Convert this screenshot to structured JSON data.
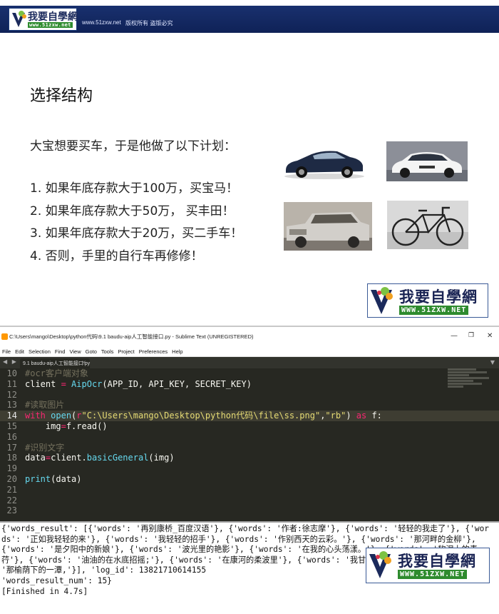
{
  "slide": {
    "header": {
      "logo_text": "我要自學網",
      "logo_url": "www.51zxw.net",
      "site": "www.51zxw.net",
      "rights": "版权所有 盗版必究"
    },
    "title": "选择结构",
    "intro": "大宝想要买车，于是他做了以下计划：",
    "plan": [
      "1. 如果年底存款大于100万，买宝马！",
      "2. 如果年底存款大于50万，  买丰田！",
      "3. 如果年底存款大于20万，买二手车！",
      "4. 否则，手里的自行车再修修！"
    ],
    "watermark_logo": {
      "text": "我要自學網",
      "url": "WWW.51ZXW.NET"
    }
  },
  "window": {
    "title": "C:\\Users\\mango\\Desktop\\python代码\\9.1 baudu-aip人工智能接口.py - Sublime Text (UNREGISTERED)",
    "controls": {
      "minimize": "—",
      "maximize": "❐",
      "close": "✕"
    },
    "menu": [
      "File",
      "Edit",
      "Selection",
      "Find",
      "View",
      "Goto",
      "Tools",
      "Project",
      "Preferences",
      "Help"
    ],
    "tab": {
      "label": "9.1 baudu-aip人工智能接口.py",
      "close": "×"
    },
    "tab_nav": "◀ ▶",
    "tab_menu": "▼"
  },
  "editor": {
    "active_line": 14,
    "lines": [
      {
        "n": "10",
        "tokens": [
          {
            "t": "#ocr客户端对象",
            "c": "comment"
          }
        ]
      },
      {
        "n": "11",
        "tokens": [
          {
            "t": "client ",
            "c": "plain"
          },
          {
            "t": "=",
            "c": "kw"
          },
          {
            "t": " ",
            "c": "plain"
          },
          {
            "t": "AipOcr",
            "c": "fn"
          },
          {
            "t": "(APP_ID, API_KEY, SECRET_KEY)",
            "c": "plain"
          }
        ]
      },
      {
        "n": "12",
        "tokens": []
      },
      {
        "n": "13",
        "tokens": [
          {
            "t": "#读取图片",
            "c": "comment"
          }
        ]
      },
      {
        "n": "14",
        "tokens": [
          {
            "t": "with",
            "c": "kw"
          },
          {
            "t": " ",
            "c": "plain"
          },
          {
            "t": "open",
            "c": "fn"
          },
          {
            "t": "(",
            "c": "plain"
          },
          {
            "t": "r",
            "c": "kw"
          },
          {
            "t": "\"C:\\Users\\mango\\Desktop\\python代码\\file\\ss.png\"",
            "c": "str"
          },
          {
            "t": ",",
            "c": "plain"
          },
          {
            "t": "\"rb\"",
            "c": "str"
          },
          {
            "t": ") ",
            "c": "plain"
          },
          {
            "t": "as",
            "c": "kw"
          },
          {
            "t": " f:",
            "c": "plain"
          }
        ]
      },
      {
        "n": "15",
        "tokens": [
          {
            "t": "    img",
            "c": "plain"
          },
          {
            "t": "=",
            "c": "kw"
          },
          {
            "t": "f.read()",
            "c": "plain"
          }
        ]
      },
      {
        "n": "16",
        "tokens": []
      },
      {
        "n": "17",
        "tokens": [
          {
            "t": "#识别文字",
            "c": "comment"
          }
        ]
      },
      {
        "n": "18",
        "tokens": [
          {
            "t": "data",
            "c": "plain"
          },
          {
            "t": "=",
            "c": "kw"
          },
          {
            "t": "client.",
            "c": "plain"
          },
          {
            "t": "basicGeneral",
            "c": "fn"
          },
          {
            "t": "(img)",
            "c": "plain"
          }
        ]
      },
      {
        "n": "19",
        "tokens": []
      },
      {
        "n": "20",
        "tokens": [
          {
            "t": "print",
            "c": "fn"
          },
          {
            "t": "(data)",
            "c": "plain"
          }
        ]
      },
      {
        "n": "21",
        "tokens": []
      },
      {
        "n": "22",
        "tokens": []
      },
      {
        "n": "23",
        "tokens": []
      }
    ]
  },
  "output": {
    "text": "{'words_result': [{'words': '再别康桥_百度汉语'}, {'words': '作者:徐志摩'}, {'words': '轻轻的我走了'}, {'words': '正如我轻轻的来'}, {'words': '我轻轻的招手'}, {'words': '作别西天的云彩。'}, {'words': '那河畔的金柳'}, {'words': '是夕阳中的新娘'}, {'words': '波光里的艳影'}, {'words': '在我的心头荡漾。'}, {'words': '软泥上的青荇'}, {'words': '油油的在水底招摇;'}, {'words': '在康河的柔波里'}, {'words': '我甘心做一条水草!'}, {'words': '那榆荫下的一潭,'}], 'log_id': 13821710614155\n'words_result_num': 15}\n[Finished in 4.7s]",
    "watermark_logo": {
      "text": "我要自學網",
      "url": "WWW.51ZXW.NET"
    }
  },
  "colors": {
    "header_bg": "#19306e",
    "editor_bg": "#272822",
    "comment": "#75715e",
    "keyword": "#f92672",
    "function": "#66d9ef",
    "string": "#e6db74",
    "logo_green": "#2e8b2e"
  },
  "icons": {
    "app": "sublime-icon",
    "logo_mark": "green-v-logo-icon"
  }
}
